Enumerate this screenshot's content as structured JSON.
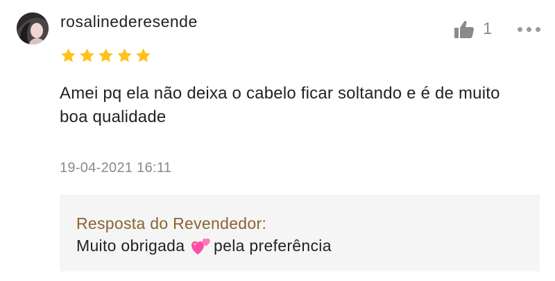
{
  "review": {
    "username": "rosalinederesende",
    "rating": 5,
    "comment": "Amei pq ela não deixa o cabelo ficar soltando e é de muito boa qualidade",
    "timestamp": "19-04-2021 16:11",
    "likes": "1",
    "icons": {
      "like": "thumbs-up-icon",
      "more": "more-options-icon",
      "star": "star-icon",
      "emoji": "two-hearts-emoji"
    },
    "colors": {
      "star": "#ffc21a",
      "reply_title": "#8a6332",
      "muted": "#8a8a8a",
      "reply_bg": "#f5f5f5"
    }
  },
  "seller_reply": {
    "title": "Resposta do Revendedor:",
    "text_before_emoji": "Muito obrigada ",
    "text_after_emoji": "pela preferência"
  }
}
